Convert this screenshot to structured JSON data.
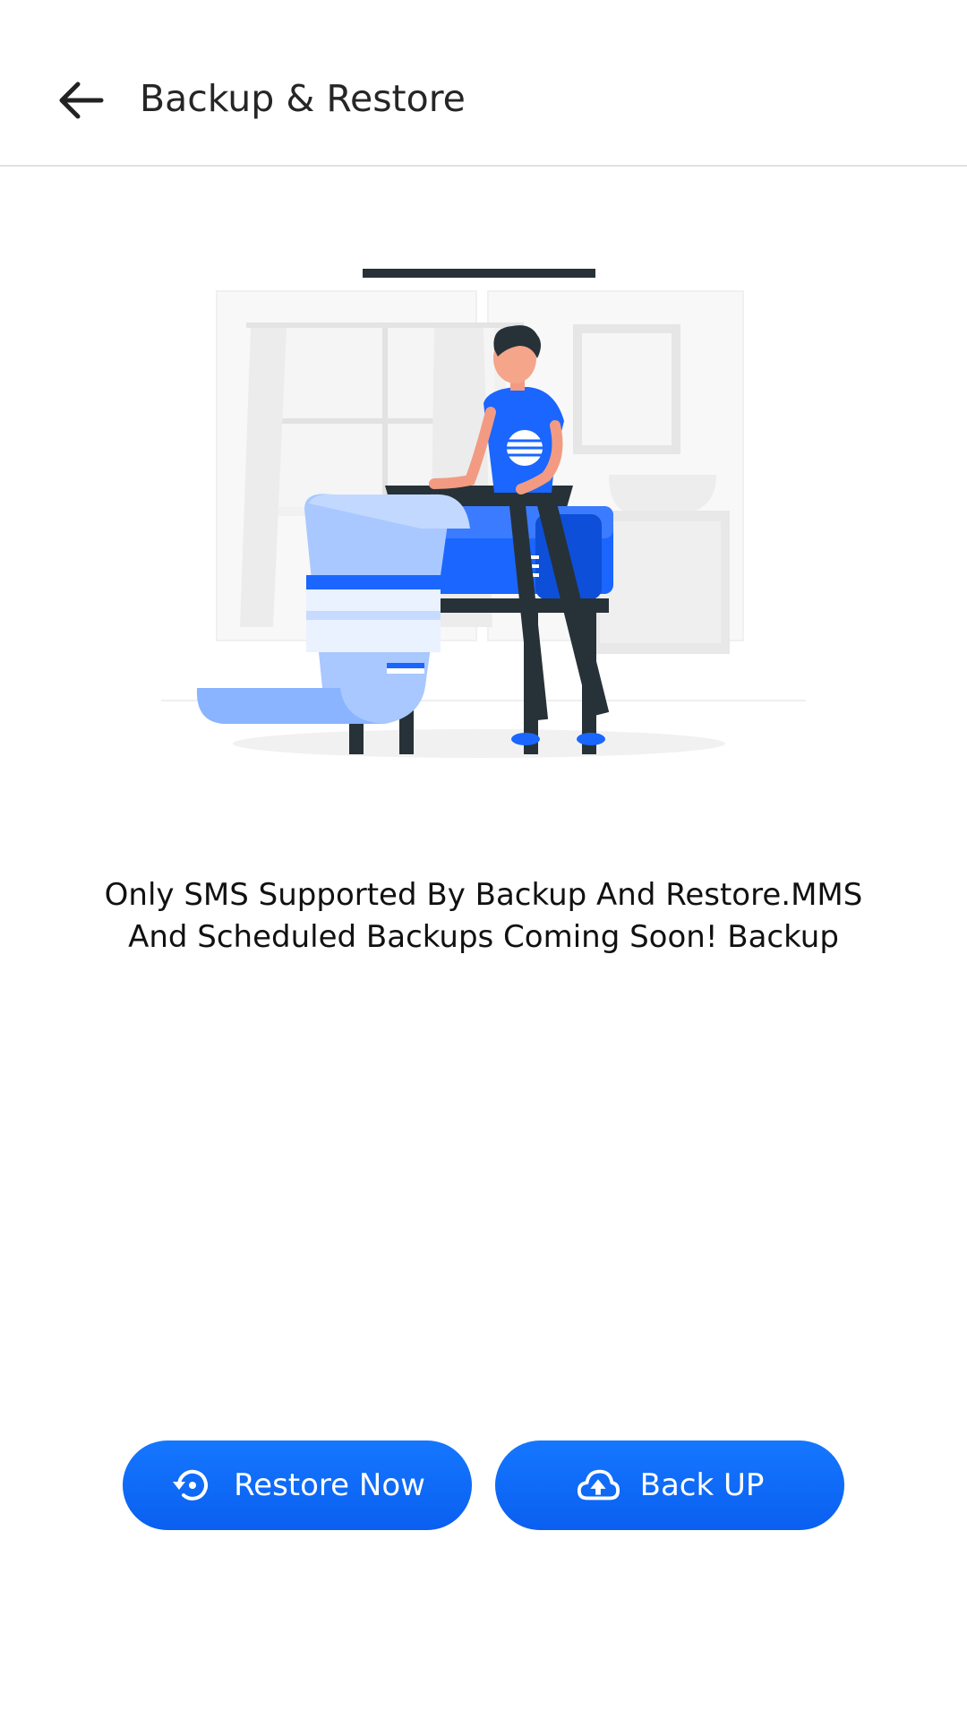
{
  "header": {
    "title": "Backup & Restore"
  },
  "main": {
    "message": "Only SMS Supported By Backup And Restore.MMS And Scheduled Backups Coming Soon! Backup"
  },
  "actions": {
    "restore_label": "Restore Now",
    "backup_label": "Back UP"
  },
  "icons": {
    "back": "arrow-left-icon",
    "restore": "restore-history-icon",
    "backup": "cloud-upload-icon"
  },
  "colors": {
    "accent": "#0a66ff",
    "title_text": "#262626",
    "divider": "#e2e2e2"
  }
}
